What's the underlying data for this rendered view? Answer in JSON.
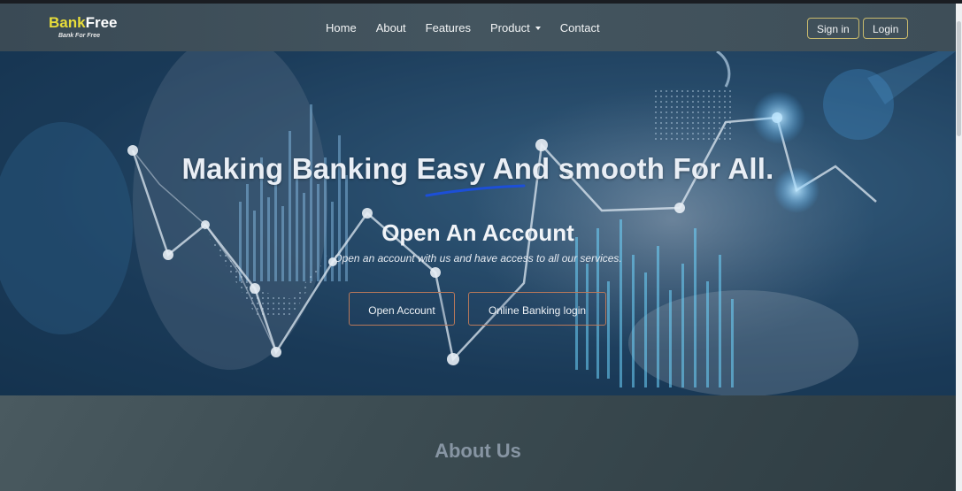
{
  "brand": {
    "name_part1": "Bank",
    "name_part2": "Free",
    "tagline": "Bank For Free"
  },
  "nav": {
    "links": [
      {
        "label": "Home"
      },
      {
        "label": "About"
      },
      {
        "label": "Features"
      },
      {
        "label": "Product",
        "has_dropdown": true
      },
      {
        "label": "Contact"
      }
    ],
    "signin_label": "Sign in",
    "login_label": "Login"
  },
  "hero": {
    "title": "Making Banking Easy And smooth For All.",
    "subtitle": "Open An Account",
    "description": "Open an account with us and have access to all our services.",
    "open_account_label": "Open Account",
    "online_banking_label": "Online Banking login"
  },
  "about": {
    "title": "About Us"
  },
  "colors": {
    "brand_accent": "#e8dd3a",
    "button_border": "#c9ba6d",
    "underline": "#1c4fd8"
  }
}
